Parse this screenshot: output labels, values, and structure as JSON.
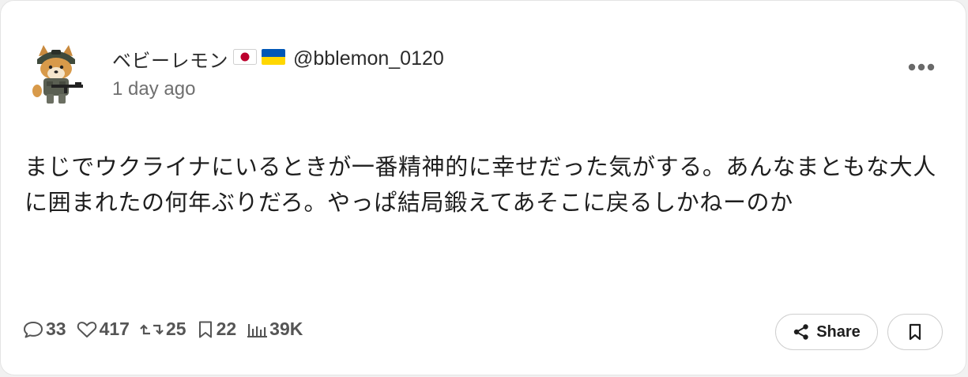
{
  "author": {
    "display_name": "ベビーレモン",
    "flags": [
      "japan-flag-icon",
      "ukraine-flag-icon"
    ],
    "handle": "@bblemon_0120",
    "avatar": "shiba-soldier-avatar"
  },
  "post": {
    "timestamp": "1 day ago",
    "text": "まじでウクライナにいるときが一番精神的に幸せだった気がする。あんなまともな大人に囲まれたの何年ぶりだろ。やっぱ結局鍛えてあそこに戻るしかねーのか"
  },
  "stats": {
    "replies": "33",
    "likes": "417",
    "reposts": "25",
    "bookmarks": "22",
    "views": "39K"
  },
  "actions": {
    "share_label": "Share"
  },
  "colors": {
    "background": "#ffffff",
    "text": "#1e1e1e",
    "muted": "#6f6f6f",
    "flag_red": "#bc002d",
    "flag_blue": "#0057b7",
    "flag_yellow": "#ffd700"
  }
}
